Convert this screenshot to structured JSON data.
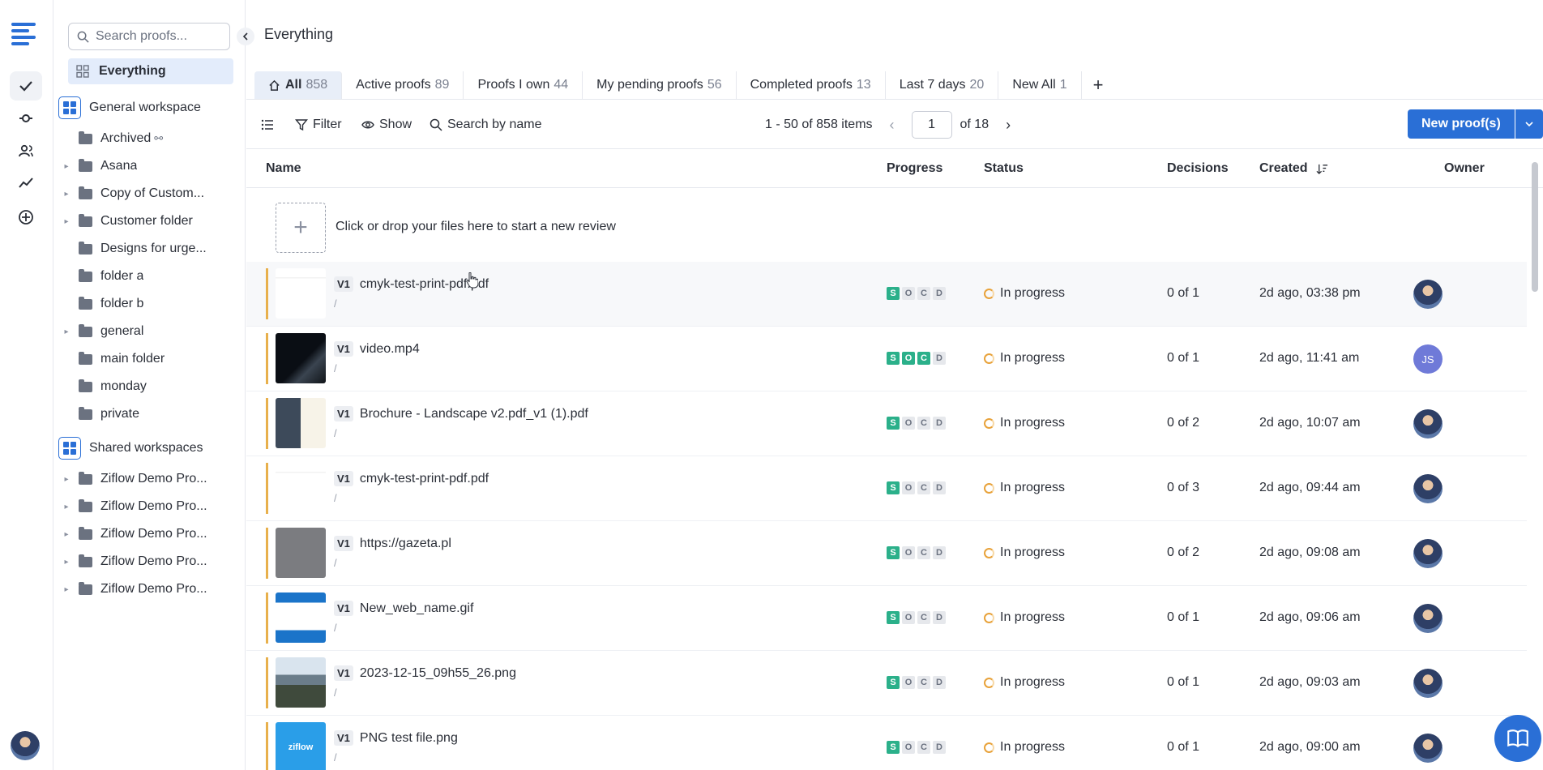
{
  "sidebar": {
    "search_placeholder": "Search proofs...",
    "everything_label": "Everything",
    "general_workspace": "General workspace",
    "folders": [
      {
        "label": "Archived",
        "expandable": false
      },
      {
        "label": "Asana",
        "expandable": true
      },
      {
        "label": "Copy of Custom...",
        "expandable": true
      },
      {
        "label": "Customer folder",
        "expandable": true
      },
      {
        "label": "Designs for urge...",
        "expandable": false
      },
      {
        "label": "folder a",
        "expandable": false
      },
      {
        "label": "folder b",
        "expandable": false
      },
      {
        "label": "general",
        "expandable": true
      },
      {
        "label": "main folder",
        "expandable": false
      },
      {
        "label": "monday",
        "expandable": false
      },
      {
        "label": "private",
        "expandable": false
      }
    ],
    "shared_workspaces": "Shared workspaces",
    "shared_folders": [
      {
        "label": "Ziflow Demo Pro..."
      },
      {
        "label": "Ziflow Demo Pro..."
      },
      {
        "label": "Ziflow Demo Pro..."
      },
      {
        "label": "Ziflow Demo Pro..."
      },
      {
        "label": "Ziflow Demo Pro..."
      }
    ]
  },
  "header": {
    "title": "Everything"
  },
  "tabs": [
    {
      "label": "All",
      "count": "858"
    },
    {
      "label": "Active proofs",
      "count": "89"
    },
    {
      "label": "Proofs I own",
      "count": "44"
    },
    {
      "label": "My pending proofs",
      "count": "56"
    },
    {
      "label": "Completed proofs",
      "count": "13"
    },
    {
      "label": "Last 7 days",
      "count": "20"
    },
    {
      "label": "New All",
      "count": "1"
    }
  ],
  "toolbar": {
    "filter": "Filter",
    "show": "Show",
    "search": "Search by name",
    "range": "1 - 50 of 858 items",
    "page": "1",
    "of_pages": "of 18",
    "new_proof": "New proof(s)"
  },
  "columns": {
    "name": "Name",
    "progress": "Progress",
    "status": "Status",
    "decisions": "Decisions",
    "created": "Created",
    "owner": "Owner"
  },
  "dropzone": "Click or drop your files here to start a new review",
  "rows": [
    {
      "version": "V1",
      "name": "cmyk-test-print-pdf.pdf",
      "path": "/",
      "stages": [
        "S",
        "O",
        "C",
        "D"
      ],
      "done": 1,
      "status": "In progress",
      "decisions": "0 of 1",
      "created": "2d ago, 03:38 pm",
      "owner": "photo",
      "thumb": "cmyk"
    },
    {
      "version": "V1",
      "name": "video.mp4",
      "path": "/",
      "stages": [
        "S",
        "O",
        "C",
        "D"
      ],
      "done": 3,
      "status": "In progress",
      "decisions": "0 of 1",
      "created": "2d ago, 11:41 am",
      "owner": "JS",
      "thumb": "video"
    },
    {
      "version": "V1",
      "name": "Brochure - Landscape v2.pdf_v1 (1).pdf",
      "path": "/",
      "stages": [
        "S",
        "O",
        "C",
        "D"
      ],
      "done": 1,
      "status": "In progress",
      "decisions": "0 of 2",
      "created": "2d ago, 10:07 am",
      "owner": "photo",
      "thumb": "brochure"
    },
    {
      "version": "V1",
      "name": "cmyk-test-print-pdf.pdf",
      "path": "/",
      "stages": [
        "S",
        "O",
        "C",
        "D"
      ],
      "done": 1,
      "status": "In progress",
      "decisions": "0 of 3",
      "created": "2d ago, 09:44 am",
      "owner": "photo",
      "thumb": "cmyk"
    },
    {
      "version": "V1",
      "name": "https://gazeta.pl",
      "path": "/",
      "stages": [
        "S",
        "O",
        "C",
        "D"
      ],
      "done": 1,
      "status": "In progress",
      "decisions": "0 of 2",
      "created": "2d ago, 09:08 am",
      "owner": "photo",
      "thumb": "gray"
    },
    {
      "version": "V1",
      "name": "New_web_name.gif",
      "path": "/",
      "stages": [
        "S",
        "O",
        "C",
        "D"
      ],
      "done": 1,
      "status": "In progress",
      "decisions": "0 of 1",
      "created": "2d ago, 09:06 am",
      "owner": "photo",
      "thumb": "web"
    },
    {
      "version": "V1",
      "name": "2023-12-15_09h55_26.png",
      "path": "/",
      "stages": [
        "S",
        "O",
        "C",
        "D"
      ],
      "done": 1,
      "status": "In progress",
      "decisions": "0 of 1",
      "created": "2d ago, 09:03 am",
      "owner": "photo",
      "thumb": "photo"
    },
    {
      "version": "V1",
      "name": "PNG test file.png",
      "path": "/",
      "stages": [
        "S",
        "O",
        "C",
        "D"
      ],
      "done": 1,
      "status": "In progress",
      "decisions": "0 of 1",
      "created": "2d ago, 09:00 am",
      "owner": "photo",
      "thumb": "ziflow",
      "thumb_text": "ziflow"
    }
  ],
  "colors": {
    "accent": "#2a6fd6",
    "stage_done": "#2bb08a",
    "progress_bar": "#e8b04c"
  }
}
